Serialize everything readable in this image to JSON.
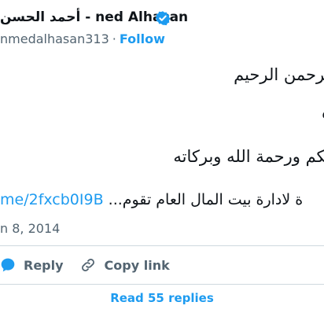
{
  "author": {
    "display_name": "أحمد الحسن - ned Alhasan",
    "handle": "nmedalhasan313",
    "follow_label": "Follow"
  },
  "tweet": {
    "line1": "لرحمن الرحيم",
    "line2": "ه",
    "line3": "يكم ورحمة الله وبركاته",
    "line4_link": "me/2fxcb0I9B",
    "line4_text": "ة لادارة بيت المال العام تقوم..."
  },
  "timestamp": "n 8, 2014",
  "actions": {
    "reply_label": "Reply",
    "copy_link_label": "Copy link"
  },
  "read_replies_label": "Read 55 replies",
  "colors": {
    "accent": "#1d9bf0",
    "secondary_text": "#536471",
    "divider": "#cfd9de"
  },
  "icons": {
    "verified": "verified-badge-icon",
    "reply": "reply-bubble-icon",
    "copy_link": "link-icon"
  }
}
